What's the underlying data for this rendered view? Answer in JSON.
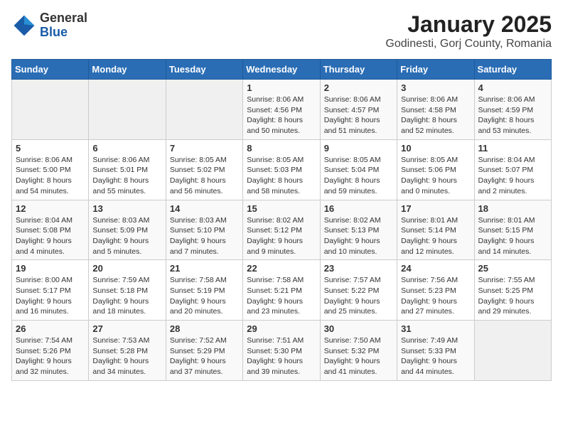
{
  "logo": {
    "general": "General",
    "blue": "Blue"
  },
  "title": "January 2025",
  "subtitle": "Godinesti, Gorj County, Romania",
  "weekdays": [
    "Sunday",
    "Monday",
    "Tuesday",
    "Wednesday",
    "Thursday",
    "Friday",
    "Saturday"
  ],
  "weeks": [
    [
      {
        "day": "",
        "info": ""
      },
      {
        "day": "",
        "info": ""
      },
      {
        "day": "",
        "info": ""
      },
      {
        "day": "1",
        "info": "Sunrise: 8:06 AM\nSunset: 4:56 PM\nDaylight: 8 hours\nand 50 minutes."
      },
      {
        "day": "2",
        "info": "Sunrise: 8:06 AM\nSunset: 4:57 PM\nDaylight: 8 hours\nand 51 minutes."
      },
      {
        "day": "3",
        "info": "Sunrise: 8:06 AM\nSunset: 4:58 PM\nDaylight: 8 hours\nand 52 minutes."
      },
      {
        "day": "4",
        "info": "Sunrise: 8:06 AM\nSunset: 4:59 PM\nDaylight: 8 hours\nand 53 minutes."
      }
    ],
    [
      {
        "day": "5",
        "info": "Sunrise: 8:06 AM\nSunset: 5:00 PM\nDaylight: 8 hours\nand 54 minutes."
      },
      {
        "day": "6",
        "info": "Sunrise: 8:06 AM\nSunset: 5:01 PM\nDaylight: 8 hours\nand 55 minutes."
      },
      {
        "day": "7",
        "info": "Sunrise: 8:05 AM\nSunset: 5:02 PM\nDaylight: 8 hours\nand 56 minutes."
      },
      {
        "day": "8",
        "info": "Sunrise: 8:05 AM\nSunset: 5:03 PM\nDaylight: 8 hours\nand 58 minutes."
      },
      {
        "day": "9",
        "info": "Sunrise: 8:05 AM\nSunset: 5:04 PM\nDaylight: 8 hours\nand 59 minutes."
      },
      {
        "day": "10",
        "info": "Sunrise: 8:05 AM\nSunset: 5:06 PM\nDaylight: 9 hours\nand 0 minutes."
      },
      {
        "day": "11",
        "info": "Sunrise: 8:04 AM\nSunset: 5:07 PM\nDaylight: 9 hours\nand 2 minutes."
      }
    ],
    [
      {
        "day": "12",
        "info": "Sunrise: 8:04 AM\nSunset: 5:08 PM\nDaylight: 9 hours\nand 4 minutes."
      },
      {
        "day": "13",
        "info": "Sunrise: 8:03 AM\nSunset: 5:09 PM\nDaylight: 9 hours\nand 5 minutes."
      },
      {
        "day": "14",
        "info": "Sunrise: 8:03 AM\nSunset: 5:10 PM\nDaylight: 9 hours\nand 7 minutes."
      },
      {
        "day": "15",
        "info": "Sunrise: 8:02 AM\nSunset: 5:12 PM\nDaylight: 9 hours\nand 9 minutes."
      },
      {
        "day": "16",
        "info": "Sunrise: 8:02 AM\nSunset: 5:13 PM\nDaylight: 9 hours\nand 10 minutes."
      },
      {
        "day": "17",
        "info": "Sunrise: 8:01 AM\nSunset: 5:14 PM\nDaylight: 9 hours\nand 12 minutes."
      },
      {
        "day": "18",
        "info": "Sunrise: 8:01 AM\nSunset: 5:15 PM\nDaylight: 9 hours\nand 14 minutes."
      }
    ],
    [
      {
        "day": "19",
        "info": "Sunrise: 8:00 AM\nSunset: 5:17 PM\nDaylight: 9 hours\nand 16 minutes."
      },
      {
        "day": "20",
        "info": "Sunrise: 7:59 AM\nSunset: 5:18 PM\nDaylight: 9 hours\nand 18 minutes."
      },
      {
        "day": "21",
        "info": "Sunrise: 7:58 AM\nSunset: 5:19 PM\nDaylight: 9 hours\nand 20 minutes."
      },
      {
        "day": "22",
        "info": "Sunrise: 7:58 AM\nSunset: 5:21 PM\nDaylight: 9 hours\nand 23 minutes."
      },
      {
        "day": "23",
        "info": "Sunrise: 7:57 AM\nSunset: 5:22 PM\nDaylight: 9 hours\nand 25 minutes."
      },
      {
        "day": "24",
        "info": "Sunrise: 7:56 AM\nSunset: 5:23 PM\nDaylight: 9 hours\nand 27 minutes."
      },
      {
        "day": "25",
        "info": "Sunrise: 7:55 AM\nSunset: 5:25 PM\nDaylight: 9 hours\nand 29 minutes."
      }
    ],
    [
      {
        "day": "26",
        "info": "Sunrise: 7:54 AM\nSunset: 5:26 PM\nDaylight: 9 hours\nand 32 minutes."
      },
      {
        "day": "27",
        "info": "Sunrise: 7:53 AM\nSunset: 5:28 PM\nDaylight: 9 hours\nand 34 minutes."
      },
      {
        "day": "28",
        "info": "Sunrise: 7:52 AM\nSunset: 5:29 PM\nDaylight: 9 hours\nand 37 minutes."
      },
      {
        "day": "29",
        "info": "Sunrise: 7:51 AM\nSunset: 5:30 PM\nDaylight: 9 hours\nand 39 minutes."
      },
      {
        "day": "30",
        "info": "Sunrise: 7:50 AM\nSunset: 5:32 PM\nDaylight: 9 hours\nand 41 minutes."
      },
      {
        "day": "31",
        "info": "Sunrise: 7:49 AM\nSunset: 5:33 PM\nDaylight: 9 hours\nand 44 minutes."
      },
      {
        "day": "",
        "info": ""
      }
    ]
  ]
}
